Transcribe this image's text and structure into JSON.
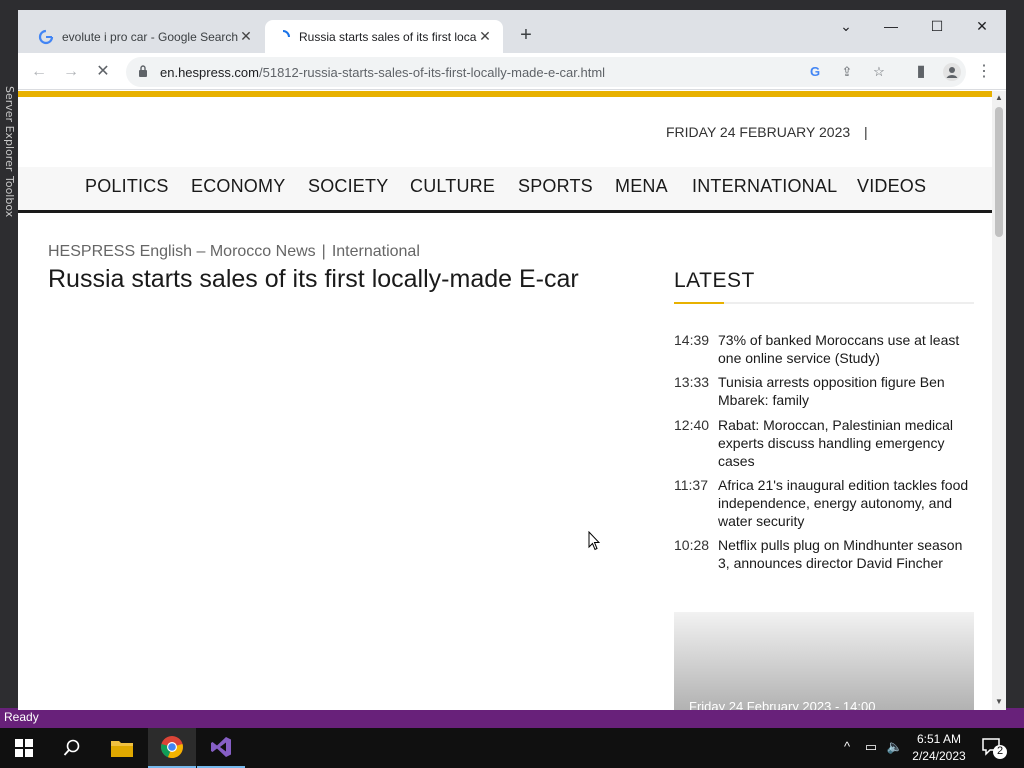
{
  "browser": {
    "tabs": [
      {
        "label": "evolute i pro car - Google Search",
        "active": false
      },
      {
        "label": "Russia starts sales of its first loca",
        "active": true
      }
    ],
    "url_host": "en.hespress.com",
    "url_path": "/51812-russia-starts-sales-of-its-first-locally-made-e-car.html"
  },
  "site": {
    "date": "FRIDAY 24 FEBRUARY 2023",
    "date_sep": "|",
    "nav": [
      "POLITICS",
      "ECONOMY",
      "SOCIETY",
      "CULTURE",
      "SPORTS",
      "MENA",
      "INTERNATIONAL",
      "VIDEOS"
    ],
    "accent_color": "#e8b100"
  },
  "article": {
    "breadcrumb_home": "HESPRESS English – Morocco News",
    "breadcrumb_sep": "|",
    "breadcrumb_section": "International",
    "title": "Russia starts sales of its first locally-made E-car"
  },
  "latest": {
    "heading": "LATEST",
    "items": [
      {
        "time": "14:39",
        "text": "73% of banked Moroccans use at least one online service (Study)"
      },
      {
        "time": "13:33",
        "text": "Tunisia arrests opposition figure Ben Mbarek: family"
      },
      {
        "time": "12:40",
        "text": "Rabat: Moroccan, Palestinian medical experts discuss handling emergency cases"
      },
      {
        "time": "11:37",
        "text": "Africa 21's inaugural edition tackles food independence, energy autonomy, and water security"
      },
      {
        "time": "10:28",
        "text": "Netflix pulls plug on Mindhunter season 3, announces director David Fincher"
      }
    ],
    "card_caption": "Friday 24 February 2023 - 14:00"
  },
  "ide": {
    "status": "Ready",
    "side_labels": [
      "Server Explorer",
      "Toolbox"
    ]
  },
  "taskbar": {
    "time": "6:51 AM",
    "date": "2/24/2023",
    "notification_count": "2"
  }
}
